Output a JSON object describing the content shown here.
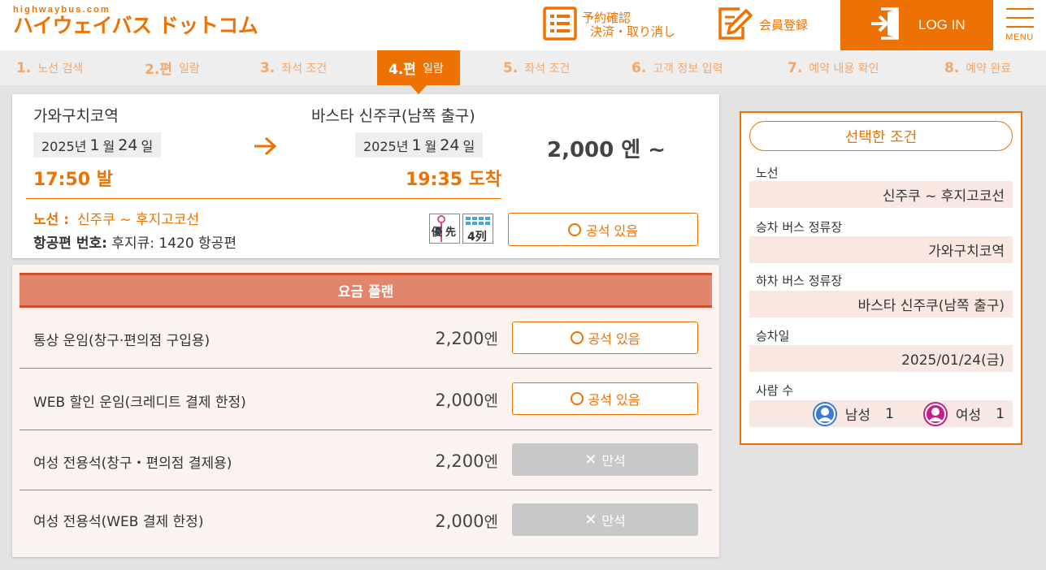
{
  "header": {
    "logo_sub": "highwaybus.com",
    "logo_main": "ハイウェイバス ドットコム",
    "reserve_line1": "予約確認",
    "reserve_line2": "決済・取り消し",
    "member_label": "会員登録",
    "login_label": "LOG IN",
    "menu_label": "MENU"
  },
  "steps": [
    {
      "num": "1.",
      "label": "노선 검색"
    },
    {
      "num": "2.편",
      "label": "일람"
    },
    {
      "num": "3.",
      "label": "좌석 조건"
    },
    {
      "num": "4.편",
      "label": "일람"
    },
    {
      "num": "5.",
      "label": "좌석 조건"
    },
    {
      "num": "6.",
      "label": "고객 정보 입력"
    },
    {
      "num": "7.",
      "label": "예약 내용 확인"
    },
    {
      "num": "8.",
      "label": "예약 완료"
    }
  ],
  "trip": {
    "from_station": "가와구치코역",
    "to_station": "바스타 신주쿠(남쪽 출구)",
    "dep_year": "2025년",
    "dep_month": "1",
    "dep_month_unit": "월",
    "dep_day": "24",
    "dep_day_unit": "일",
    "arr_year": "2025년",
    "arr_month": "1",
    "arr_month_unit": "월",
    "arr_day": "24",
    "arr_day_unit": "일",
    "dep_time": "17:50 발",
    "arr_time": "19:35 도착",
    "price_from": "2,000 엔 ~",
    "route_label": "노선 :",
    "route_value": "신주쿠 ~ 후지고코선",
    "flight_label": "항공편 번호:",
    "flight_value": "후지큐: 1420 항공편",
    "badge_priority_1": "優",
    "badge_priority_2": "先",
    "badge_rows": "4列",
    "seat_status": "공석 있음"
  },
  "plans": {
    "header": "요금 플랜",
    "rows": [
      {
        "name": "통상 운임(창구·편의점 구입용)",
        "price": "2,200",
        "unit": "엔",
        "status": "공석 있음",
        "available": true
      },
      {
        "name": "WEB 할인 운임(크레디트 결제 한정)",
        "price": "2,000",
        "unit": "엔",
        "status": "공석 있음",
        "available": true
      },
      {
        "name": "여성 전용석(창구・편의점 결제용)",
        "price": "2,200",
        "unit": "엔",
        "status": "만석",
        "available": false
      },
      {
        "name": "여성 전용석(WEB 결제 한정)",
        "price": "2,000",
        "unit": "엔",
        "status": "만석",
        "available": false
      }
    ]
  },
  "side": {
    "title": "선택한 조건",
    "route_label": "노선",
    "route_value": "신주쿠 ~ 후지고코선",
    "board_label": "승차 버스 정류장",
    "board_value": "가와구치코역",
    "alight_label": "하차 버스 정류장",
    "alight_value": "바스타 신주쿠(남쪽 출구)",
    "date_label": "승차일",
    "date_value": "2025/01/24(금)",
    "people_label": "사람 수",
    "male_label": "남성",
    "male_count": "1",
    "female_label": "여성",
    "female_count": "1"
  },
  "colors": {
    "brand_orange": "#ee7203",
    "plan_header": "#e2856d",
    "male_avatar": "#3a7bd5",
    "female_avatar": "#c81c86"
  },
  "icons": [
    "list-icon",
    "edit-icon",
    "login-door-icon",
    "hamburger-icon",
    "arrow-right-icon",
    "circle-icon",
    "x-icon",
    "male-avatar-icon",
    "female-avatar-icon"
  ]
}
